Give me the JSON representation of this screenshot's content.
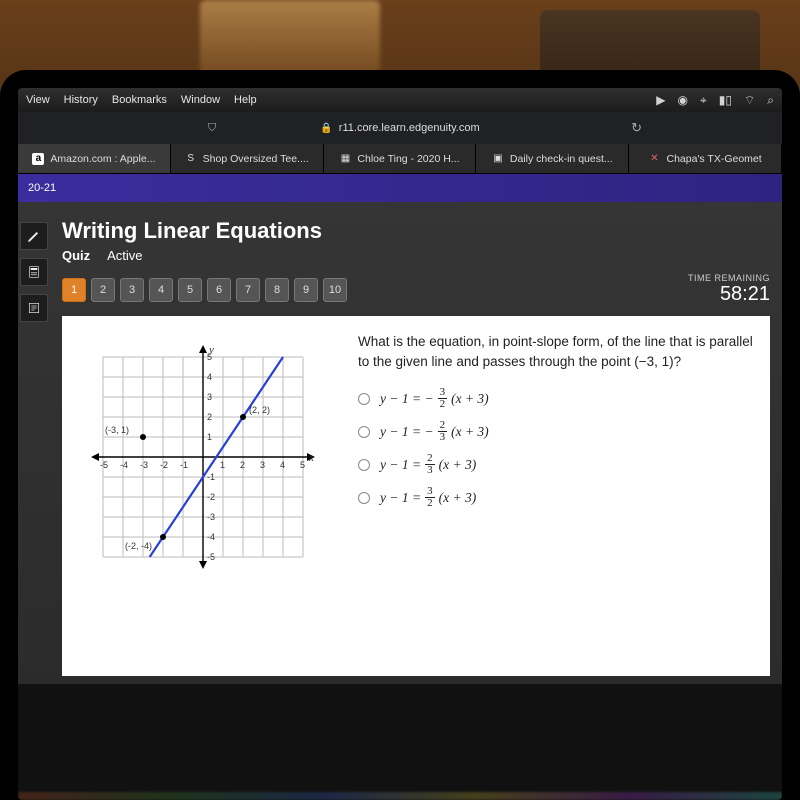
{
  "mac_menu": {
    "items": [
      "View",
      "History",
      "Bookmarks",
      "Window",
      "Help"
    ],
    "status_icons": [
      "play-icon",
      "record-icon",
      "bluetooth-icon",
      "battery-icon",
      "wifi-icon",
      "search-icon"
    ]
  },
  "browser": {
    "url": "r11.core.learn.edgenuity.com"
  },
  "tabs": [
    {
      "label": "Amazon.com : Apple...",
      "icon": "a",
      "active": true
    },
    {
      "label": "Shop Oversized Tee....",
      "icon": "S"
    },
    {
      "label": "Chloe Ting - 2020 H...",
      "icon": "▦"
    },
    {
      "label": "Daily check-in quest...",
      "icon": "▣"
    },
    {
      "label": "Chapa's TX-Geomet",
      "icon": "✕"
    }
  ],
  "course_bar": "20-21",
  "lesson": {
    "title": "Writing Linear Equations",
    "type": "Quiz",
    "status": "Active"
  },
  "question_nav": {
    "count": 10,
    "active": 1
  },
  "timer": {
    "label": "TIME REMAINING",
    "value": "58:21"
  },
  "question": {
    "prompt": "What is the equation, in point-slope form, of the line that is parallel to the given line and passes through the point (−3, 1)?",
    "options": [
      {
        "prefix": "y − 1 = −",
        "num": "3",
        "den": "2",
        "suffix": "(x + 3)"
      },
      {
        "prefix": "y − 1 = −",
        "num": "2",
        "den": "3",
        "suffix": "(x + 3)"
      },
      {
        "prefix": "y − 1 = ",
        "num": "2",
        "den": "3",
        "suffix": "(x + 3)"
      },
      {
        "prefix": "y − 1 = ",
        "num": "3",
        "den": "2",
        "suffix": "(x + 3)"
      }
    ]
  },
  "chart_data": {
    "type": "line",
    "title": "",
    "xlabel": "x",
    "ylabel": "y",
    "xlim": [
      -5,
      5
    ],
    "ylim": [
      -5,
      5
    ],
    "grid": true,
    "series": [
      {
        "name": "given line",
        "points": [
          [
            -2,
            -4
          ],
          [
            2,
            2
          ]
        ],
        "extend": true
      }
    ],
    "annotations": [
      {
        "type": "point",
        "x": -3,
        "y": 1,
        "label": "(-3, 1)",
        "filled": true
      },
      {
        "type": "point",
        "x": 2,
        "y": 2,
        "label": "(2, 2)"
      },
      {
        "type": "point",
        "x": -2,
        "y": -4,
        "label": "(-2, -4)"
      }
    ]
  }
}
